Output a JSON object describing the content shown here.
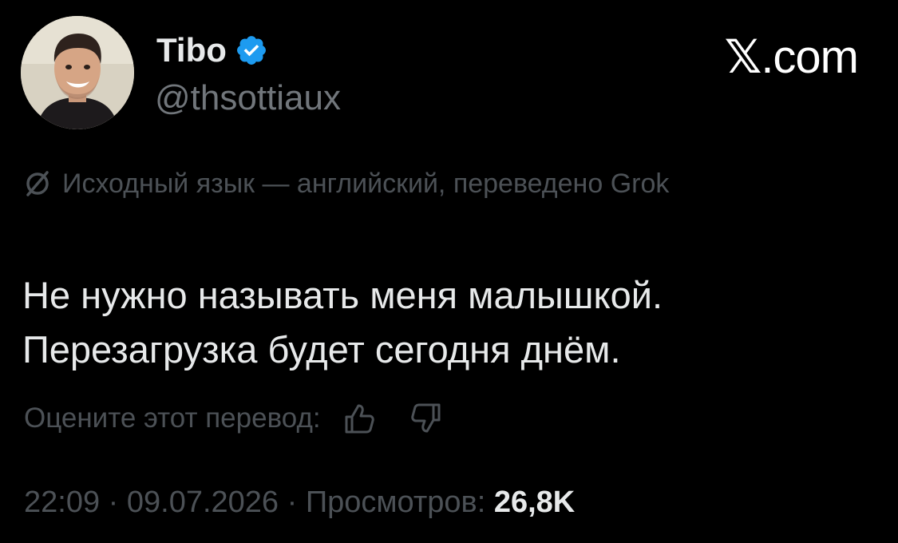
{
  "author": {
    "name": "Tibo",
    "handle": "@thsottiaux",
    "verified": true
  },
  "site": {
    "mark": "𝕏",
    "label": ".com"
  },
  "translation": {
    "note": "Исходный язык — английский, переведено Grok",
    "icon": "no-translate-icon"
  },
  "tweet": {
    "lines": [
      "Не нужно называть меня малышкой.",
      "Перезагрузка будет сегодня днём."
    ]
  },
  "rating": {
    "label": "Оцените этот перевод:",
    "up_icon": "thumbs-up-icon",
    "down_icon": "thumbs-down-icon"
  },
  "meta": {
    "time": "22:09",
    "separator": " · ",
    "date": "09.07.2026",
    "views_label": "Просмотров:",
    "views_count": "26,8K"
  },
  "colors": {
    "background": "#000000",
    "text_primary": "#e7e9ea",
    "text_secondary": "#71767b",
    "text_muted": "#4c5156",
    "verified_badge": "#1d9bf0"
  }
}
